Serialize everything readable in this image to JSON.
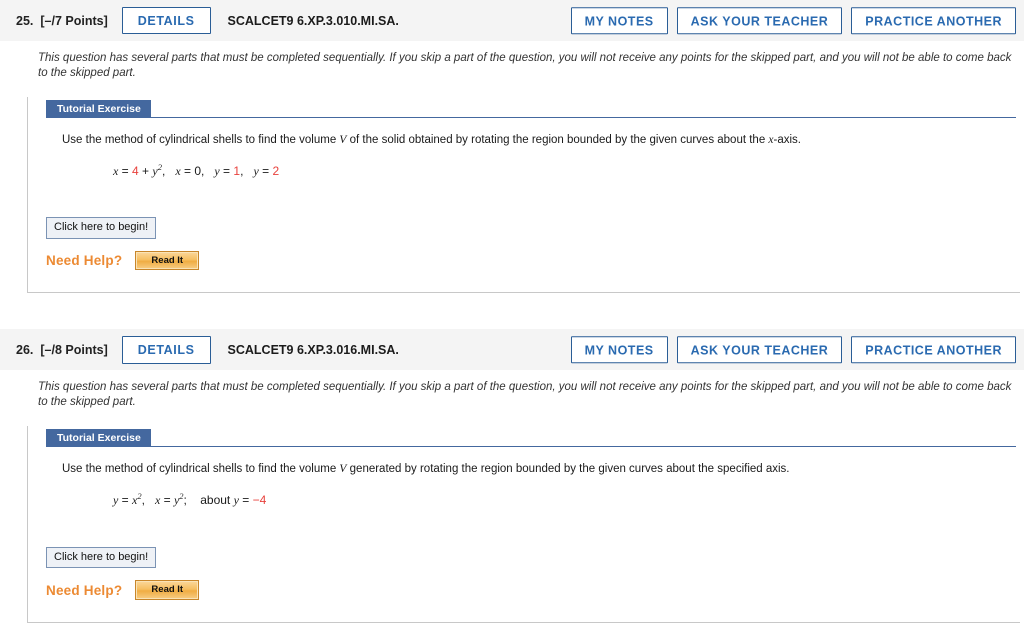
{
  "page": {
    "background": "#ffffff",
    "accent_blue": "#2a6ab0",
    "tab_blue": "#44689f",
    "help_orange": "#ec8a33",
    "red": "#e8413c"
  },
  "questions": [
    {
      "number": "25.",
      "points": "[–/7 Points]",
      "details_label": "DETAILS",
      "code": "SCALCET9 6.XP.3.010.MI.SA.",
      "actions": [
        {
          "label": "MY NOTES"
        },
        {
          "label": "ASK YOUR TEACHER"
        },
        {
          "label": "PRACTICE ANOTHER"
        }
      ],
      "note": "This question has several parts that must be completed sequentially. If you skip a part of the question, you will not receive any points for the skipped part, and you will not be able to come back to the skipped part.",
      "tutorial_label": "Tutorial Exercise",
      "prompt_pre": "Use the method of cylindrical shells to find the volume ",
      "prompt_var": "V",
      "prompt_post": " of the solid obtained by rotating the region bounded by the given curves about the ",
      "prompt_axis_var": "x",
      "prompt_axis_suffix": "-axis.",
      "equation": {
        "terms": [
          {
            "var": "x",
            "rel": " = ",
            "value": "4",
            "value_red": true,
            "tail": " + ",
            "tail_var": "y",
            "tail_sup": "2",
            "sep": ","
          },
          {
            "var": "x",
            "rel": " = ",
            "value": "0",
            "value_red": false,
            "sep": ","
          },
          {
            "var": "y",
            "rel": " = ",
            "value": "1",
            "value_red": true,
            "sep": ","
          },
          {
            "var": "y",
            "rel": " = ",
            "value": "2",
            "value_red": true,
            "sep": ""
          }
        ]
      },
      "begin_label": "Click here to begin!",
      "need_help_label": "Need Help?",
      "read_it_label": "Read It"
    },
    {
      "number": "26.",
      "points": "[–/8 Points]",
      "details_label": "DETAILS",
      "code": "SCALCET9 6.XP.3.016.MI.SA.",
      "actions": [
        {
          "label": "MY NOTES"
        },
        {
          "label": "ASK YOUR TEACHER"
        },
        {
          "label": "PRACTICE ANOTHER"
        }
      ],
      "note": "This question has several parts that must be completed sequentially. If you skip a part of the question, you will not receive any points for the skipped part, and you will not be able to come back to the skipped part.",
      "tutorial_label": "Tutorial Exercise",
      "prompt_pre": "Use the method of cylindrical shells to find the volume ",
      "prompt_var": "V",
      "prompt_post": " generated by rotating the region bounded by the given curves about the specified axis.",
      "prompt_axis_var": "",
      "prompt_axis_suffix": "",
      "equation": {
        "terms": [
          {
            "var": "y",
            "rel": " = ",
            "value": "",
            "value_red": false,
            "tail": "",
            "tail_var": "x",
            "tail_sup": "2",
            "sep": ","
          },
          {
            "var": "x",
            "rel": " = ",
            "value": "",
            "value_red": false,
            "tail": "",
            "tail_var": "y",
            "tail_sup": "2",
            "sep": ";"
          },
          {
            "about": "about ",
            "var": "y",
            "rel": " = ",
            "value": "−4",
            "value_red": true,
            "sep": ""
          }
        ]
      },
      "begin_label": "Click here to begin!",
      "need_help_label": "Read It",
      "need_help_text": "Need Help?",
      "read_it_label": "Read It"
    }
  ]
}
